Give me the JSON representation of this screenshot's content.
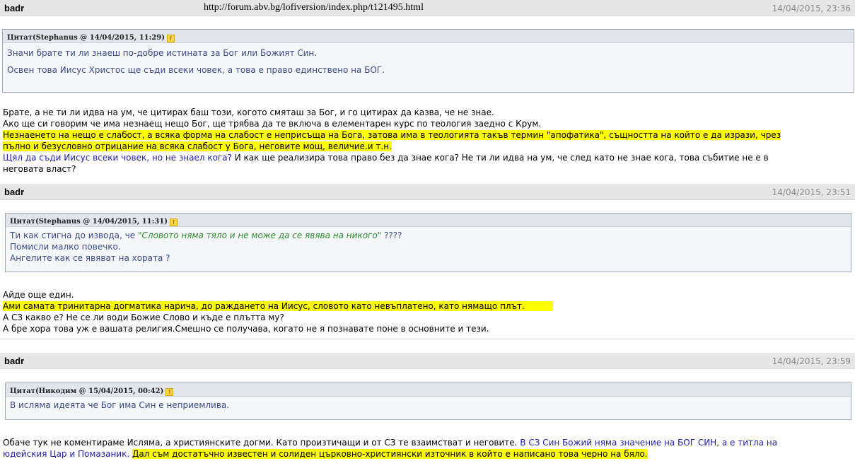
{
  "page": {
    "url": "http://forum.abv.bg/lofiversion/index.php/t121495.html"
  },
  "posts": [
    {
      "author": "badr",
      "date": "14/04/2015, 23:36",
      "quote": {
        "title": "Цитат(Stephanus @ 14/04/2015, 11:29)",
        "lines": [
          "Значи брате ти ли знаеш по-добре истината за Бог или Божият Син.",
          "Освен това Иисус Христос ще съди всеки човек, а това е право единствено на БОГ."
        ]
      },
      "body": {
        "l1": "Брате, а не ти ли идва на ум, че цитирах баш този, когото смяташ за Бог, и го цитирах да казва, че не знае.",
        "l2": "Ако ще си говорим че има незнаещ нещо Бог, ще трябва да те включа в елементарен курс по теология заедно с Крум.",
        "hl1": "Незнаенето на нещо е слабост, а всяка форма на слабост е неприсъща на Бога, затова има в теологията такъв термин \"апофатика\", същността на който е да изрази, чрез",
        "hl2": "пълно и безусловно отрицание на всяка слабост у Бога, неговите мощ, величие.и т.н.",
        "blue": "Щял да съди Иисус всеки човек, но не знаел кога?",
        "rest": " И как ще реализира това право без да знае кога? Не ти ли идва на ум, че след като не знае кога, това събитие не е в",
        "l6": "неговата власт?"
      }
    },
    {
      "author": "badr",
      "date": "14/04/2015, 23:51",
      "quote": {
        "title": "Цитат(Stephanus @ 14/04/2015, 11:31)",
        "q1a": "Ти как стигна до извода, че ",
        "q1b": "\"Словото няма тяло и не може да се явява на никого\"",
        "q1c": " ????",
        "q2": "Помисли малко повечко.",
        "q3": "Ангелите как се явяват на хората ?"
      },
      "body": {
        "l1": "Айде още един.",
        "hl": "Ами самата тринитарна догматика нарича, до раждането на Иисус, словото като невъплатено, като нямащо плът.",
        "l3": "А СЗ какво е? Не се ли води Божие Слово и къде е плътта му?",
        "l4": "А бре хора това уж е вашата религия.Смешно се получава, когато не я познавате поне в основните и тези."
      }
    },
    {
      "author": "badr",
      "date": "14/04/2015, 23:59",
      "quote": {
        "title": "Цитат(Никодим @ 15/04/2015, 00:42)",
        "q1": "В исляма идеята че Бог има Син е неприемлива."
      },
      "body": {
        "l1a": "Обаче тук не коментираме Исляма, а християнските догми. Като произтичащи и от СЗ те взаимстват и неговите. ",
        "l1b": "В СЗ Син Божий няма значение на БОГ СИН, а е титла на",
        "l2a": "юдейския Цар и Помазаник.",
        "l2b": " ",
        "l2c": "Дал съм достатъчно известен и солиден църковно-християнски източник в който е написано това черно на бяло."
      }
    }
  ]
}
